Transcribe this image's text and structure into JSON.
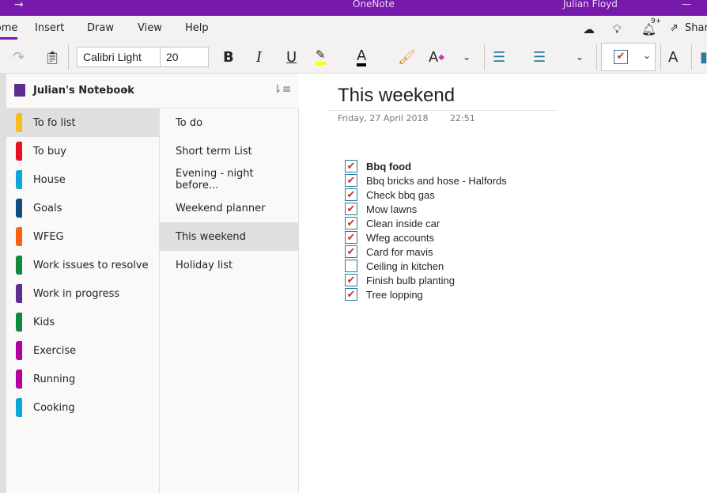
{
  "app": {
    "title": "OneNote",
    "user": "Julian Floyd"
  },
  "tabs": [
    "Home",
    "Insert",
    "Draw",
    "View",
    "Help"
  ],
  "ribbon": {
    "font_name": "Calibri Light",
    "font_size": "20",
    "bold": "B",
    "italic": "I",
    "underline": "U",
    "share": "Share",
    "notifications": "9+",
    "highlight_color": "#ffff00",
    "font_color": "#000000"
  },
  "notebook": {
    "name": "Julian's Notebook"
  },
  "sections": [
    {
      "label": "To fo list",
      "color": "#f7bd1a",
      "selected": true
    },
    {
      "label": "To buy",
      "color": "#e81123"
    },
    {
      "label": "House",
      "color": "#0ea5d9"
    },
    {
      "label": "Goals",
      "color": "#0f4c81"
    },
    {
      "label": "WFEG",
      "color": "#f7630c"
    },
    {
      "label": "Work issues to resolve",
      "color": "#10893e"
    },
    {
      "label": "Work in progress",
      "color": "#5c2d91"
    },
    {
      "label": "Kids",
      "color": "#10893e"
    },
    {
      "label": "Exercise",
      "color": "#b4009e"
    },
    {
      "label": "Running",
      "color": "#b4009e"
    },
    {
      "label": "Cooking",
      "color": "#0ea5d9"
    }
  ],
  "pages": [
    {
      "label": "To do"
    },
    {
      "label": "Short term List"
    },
    {
      "label": "Evening - night before..."
    },
    {
      "label": "Weekend planner"
    },
    {
      "label": "This weekend",
      "selected": true
    },
    {
      "label": "Holiday list"
    }
  ],
  "page": {
    "title": "This weekend",
    "date": "Friday, 27 April 2018",
    "time": "22:51",
    "todos": [
      {
        "text": "Bbq food",
        "checked": true,
        "bold": true
      },
      {
        "text": "Bbq bricks and hose - Halfords",
        "checked": true
      },
      {
        "text": "Check bbq gas",
        "checked": true
      },
      {
        "text": "Mow lawns",
        "checked": true
      },
      {
        "text": "Clean inside car",
        "checked": true
      },
      {
        "text": "Wfeg accounts",
        "checked": true
      },
      {
        "text": "Card for mavis",
        "checked": true
      },
      {
        "text": "Ceiling in kitchen",
        "checked": false
      },
      {
        "text": "Finish bulb planting",
        "checked": true
      },
      {
        "text": "Tree lopping",
        "checked": true
      }
    ]
  }
}
